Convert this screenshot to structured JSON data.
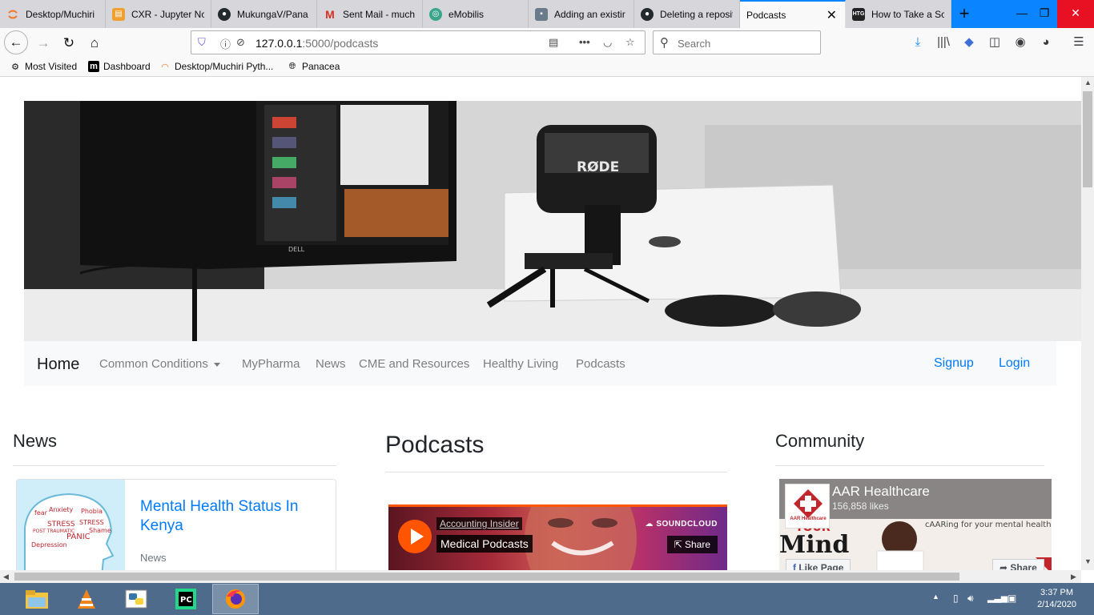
{
  "browser": {
    "tabs": [
      {
        "label": "Desktop/Muchiri",
        "icon": "jupyter-icon",
        "color": "#f37726"
      },
      {
        "label": "CXR - Jupyter Nc",
        "icon": "notebook-icon",
        "color": "#f0a030"
      },
      {
        "label": "MukungaV/Pana",
        "icon": "github-icon",
        "color": "#24292e"
      },
      {
        "label": "Sent Mail - much",
        "icon": "gmail-icon",
        "color": "#d93025"
      },
      {
        "label": "eMobilis",
        "icon": "globe-icon",
        "color": "#3aa58a"
      },
      {
        "label": "Adding an existir",
        "icon": "page-icon",
        "color": "#6a7b8c"
      },
      {
        "label": "Deleting a reposit",
        "icon": "github-icon",
        "color": "#24292e"
      },
      {
        "label": "Podcasts",
        "icon": "page-icon",
        "color": "#ffffff"
      },
      {
        "label": "How to Take a Sc",
        "icon": "htg-icon",
        "color": "#222222"
      }
    ],
    "url_main": "127.0.0.1",
    "url_rest": ":5000/podcasts",
    "search_placeholder": "Search",
    "bookmarks": [
      {
        "label": "Most Visited",
        "icon": "gear-icon"
      },
      {
        "label": "Dashboard",
        "icon": "m-logo-icon"
      },
      {
        "label": "Desktop/Muchiri Pyth...",
        "icon": "jupyter-icon"
      },
      {
        "label": "Panacea",
        "icon": "globe-icon"
      }
    ]
  },
  "site": {
    "hero_mic_brand": "RØDE",
    "hero_monitor_brand": "DELL",
    "brand": "Home",
    "nav": {
      "conditions": "Common Conditions",
      "pharma": "MyPharma",
      "news": "News",
      "cme": "CME and Resources",
      "healthy": "Healthy Living",
      "podcasts": "Podcasts",
      "signup": "Signup",
      "login": "Login"
    },
    "news_heading": "News",
    "podcasts_heading": "Podcasts",
    "community_heading": "Community",
    "news_card": {
      "title": "Mental Health Status In Kenya",
      "category": "News",
      "thumb_words": [
        "Anxiety",
        "Phobia",
        "STRESS",
        "STRESS",
        "Shame",
        "PANIC",
        "Depression",
        "fear",
        "POST TRAUMATIC"
      ]
    },
    "player": {
      "author": "Accounting Insider",
      "title": "Medical Podcasts",
      "brand": "SOUNDCLOUD",
      "share": "Share"
    },
    "facebook": {
      "page": "AAR Healthcare",
      "likes": "156,858 likes",
      "tagline": "cAARing for your mental health",
      "logo_text": "AAR Healthcare",
      "word": "Mind",
      "word_top": "YOUR",
      "like_button": "Like Page",
      "share_button": "Share"
    }
  },
  "taskbar": {
    "time": "3:37 PM",
    "date": "2/14/2020",
    "apps": [
      "file-explorer-icon",
      "vlc-icon",
      "python-idle-icon",
      "pycharm-icon",
      "firefox-icon"
    ]
  },
  "colors": {
    "firefox_blue": "#0a84ff",
    "link_blue": "#007bff",
    "soundcloud_orange": "#ff5500",
    "taskbar": "#4e6b8c"
  }
}
